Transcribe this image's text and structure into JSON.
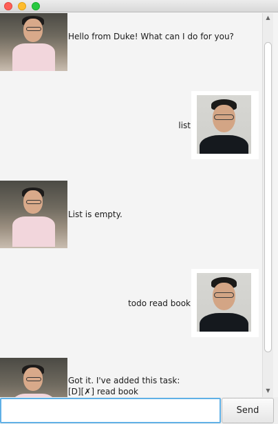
{
  "messages": [
    {
      "sender": "duke",
      "lines": [
        "Hello from Duke! What can I do for you?"
      ]
    },
    {
      "sender": "user",
      "lines": [
        "list"
      ]
    },
    {
      "sender": "duke",
      "lines": [
        "List is empty."
      ]
    },
    {
      "sender": "user",
      "lines": [
        "todo read book"
      ]
    },
    {
      "sender": "duke",
      "lines": [
        "Got it. I've added this task:",
        "[D][✗] read book"
      ]
    }
  ],
  "input": {
    "value": "",
    "placeholder": ""
  },
  "send_label": "Send"
}
